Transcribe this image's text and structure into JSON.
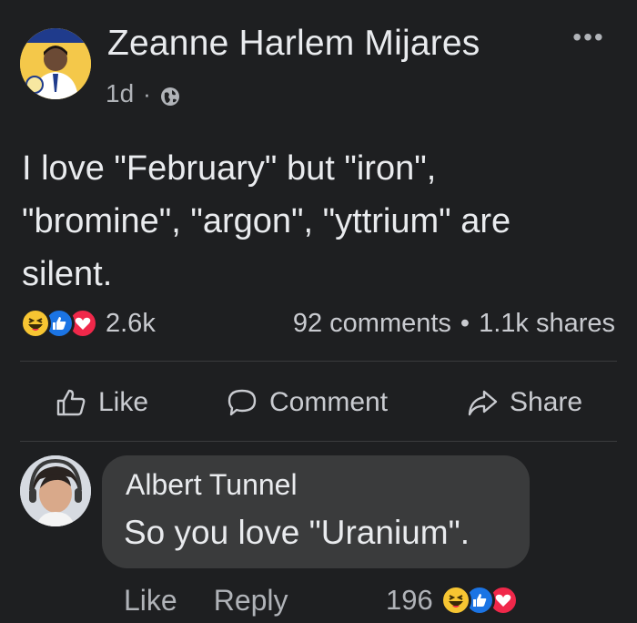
{
  "post": {
    "author": "Zeanne Harlem Mijares",
    "time": "1d",
    "separator": "·",
    "more_label": "•••",
    "privacy_icon": "globe-icon",
    "body_lines": [
      "I love \"February\" but \"iron\",",
      "\"bromine\", \"argon\", \"yttrium\" are",
      "silent."
    ]
  },
  "reactions": {
    "icons": [
      "haha-reaction-icon",
      "like-reaction-icon",
      "love-reaction-icon"
    ],
    "count": "2.6k",
    "comments": "92 comments",
    "stats_separator": "•",
    "shares": "1.1k shares"
  },
  "actions": {
    "like_label": "Like",
    "comment_label": "Comment",
    "share_label": "Share"
  },
  "comment": {
    "author": "Albert Tunnel",
    "text": "So you love \"Uranium\".",
    "like_label": "Like",
    "reply_label": "Reply",
    "reaction_count": "196"
  },
  "colors": {
    "background": "#1e1f21",
    "bubble": "#3a3b3c",
    "like_blue": "#1b74e4",
    "love_red": "#f0284a",
    "haha_yellow": "#f7c532"
  }
}
